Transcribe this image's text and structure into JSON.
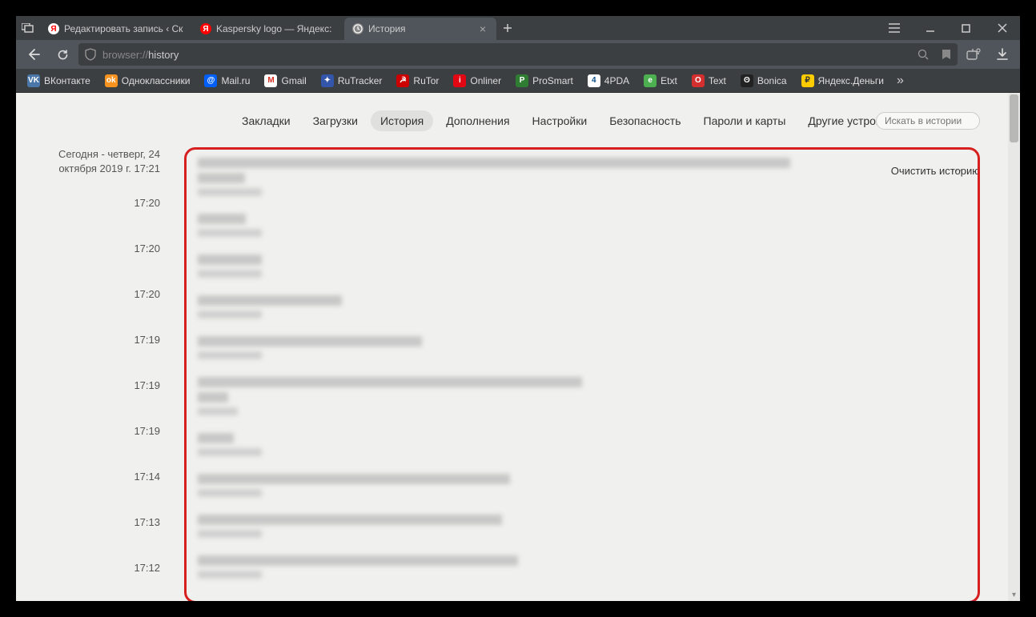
{
  "tabs": [
    {
      "title": "Редактировать запись ‹ Ск",
      "icon_bg": "#fff",
      "icon_fg": "#f00",
      "icon_text": "Я",
      "active": false,
      "closable": false
    },
    {
      "title": "Kaspersky logo — Яндекс:",
      "icon_bg": "#f00",
      "icon_fg": "#fff",
      "icon_text": "Я",
      "active": false,
      "closable": false
    },
    {
      "title": "История",
      "icon_bg": "#888",
      "icon_fg": "#fff",
      "icon_text": "",
      "active": true,
      "closable": true,
      "is_history": true
    }
  ],
  "url": {
    "prefix": "browser://",
    "path": "history"
  },
  "bookmarks": [
    {
      "label": "ВКонтакте",
      "bg": "#4a76a8",
      "glyph": "VK"
    },
    {
      "label": "Одноклассники",
      "bg": "#f7931e",
      "glyph": "ok"
    },
    {
      "label": "Mail.ru",
      "bg": "#005ff9",
      "glyph": "@"
    },
    {
      "label": "Gmail",
      "bg": "#fff",
      "glyph": "M",
      "fg": "#d93025"
    },
    {
      "label": "RuTracker",
      "bg": "#3355aa",
      "glyph": "✦"
    },
    {
      "label": "RuTor",
      "bg": "#cc0000",
      "glyph": "☭"
    },
    {
      "label": "Onliner",
      "bg": "#e30613",
      "glyph": "i"
    },
    {
      "label": "ProSmart",
      "bg": "#2e7d32",
      "glyph": "P"
    },
    {
      "label": "4PDA",
      "bg": "#fff",
      "glyph": "4",
      "fg": "#0b4f8b"
    },
    {
      "label": "Etxt",
      "bg": "#4caf50",
      "glyph": "e"
    },
    {
      "label": "Text",
      "bg": "#d32f2f",
      "glyph": "O"
    },
    {
      "label": "Bonica",
      "bg": "#222",
      "glyph": "ʘ"
    },
    {
      "label": "Яндекс.Деньги",
      "bg": "#ffcc00",
      "glyph": "₽",
      "fg": "#333"
    }
  ],
  "settings_tabs": [
    {
      "label": "Закладки",
      "active": false
    },
    {
      "label": "Загрузки",
      "active": false
    },
    {
      "label": "История",
      "active": true
    },
    {
      "label": "Дополнения",
      "active": false
    },
    {
      "label": "Настройки",
      "active": false
    },
    {
      "label": "Безопасность",
      "active": false
    },
    {
      "label": "Пароли и карты",
      "active": false
    },
    {
      "label": "Другие устройства",
      "active": false
    }
  ],
  "search": {
    "placeholder": "Искать в истории"
  },
  "clear_label": "Очистить историю",
  "today": {
    "label_line1": "Сегодня - четверг, 24",
    "label_line2": "октября 2019 г. 17:21"
  },
  "times": [
    "17:20",
    "17:20",
    "17:20",
    "17:19",
    "17:19",
    "17:19",
    "17:14",
    "17:13",
    "17:12"
  ],
  "entry_widths": [
    {
      "main": 740,
      "lines": 2
    },
    {
      "main": 60
    },
    {
      "main": 80
    },
    {
      "main": 180
    },
    {
      "main": 280
    },
    {
      "main": 480,
      "lines": 2,
      "no_sub": true
    },
    {
      "main": 45
    },
    {
      "main": 390
    },
    {
      "main": 380
    },
    {
      "main": 400
    }
  ]
}
